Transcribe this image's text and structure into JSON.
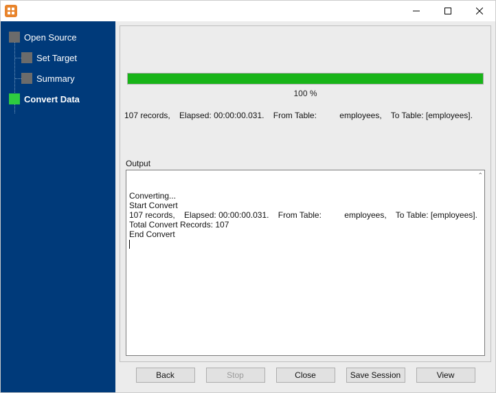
{
  "window": {
    "title": ""
  },
  "sidebar": {
    "items": [
      {
        "label": "Open Source",
        "active": false
      },
      {
        "label": "Set Target",
        "active": false
      },
      {
        "label": "Summary",
        "active": false
      },
      {
        "label": "Convert Data",
        "active": true
      }
    ]
  },
  "progress": {
    "percent_label": "100 %",
    "percent_value": 100
  },
  "status_line": "107 records,    Elapsed: 00:00:00.031.    From Table:          employees,    To Table: [employees].",
  "output": {
    "label": "Output",
    "lines": [
      "Converting...",
      "Start Convert",
      "107 records,    Elapsed: 00:00:00.031.    From Table:          employees,    To Table: [employees].",
      "Total Convert Records: 107",
      "End Convert"
    ]
  },
  "buttons": {
    "back": "Back",
    "stop": "Stop",
    "close": "Close",
    "save_session": "Save Session",
    "view": "View"
  }
}
